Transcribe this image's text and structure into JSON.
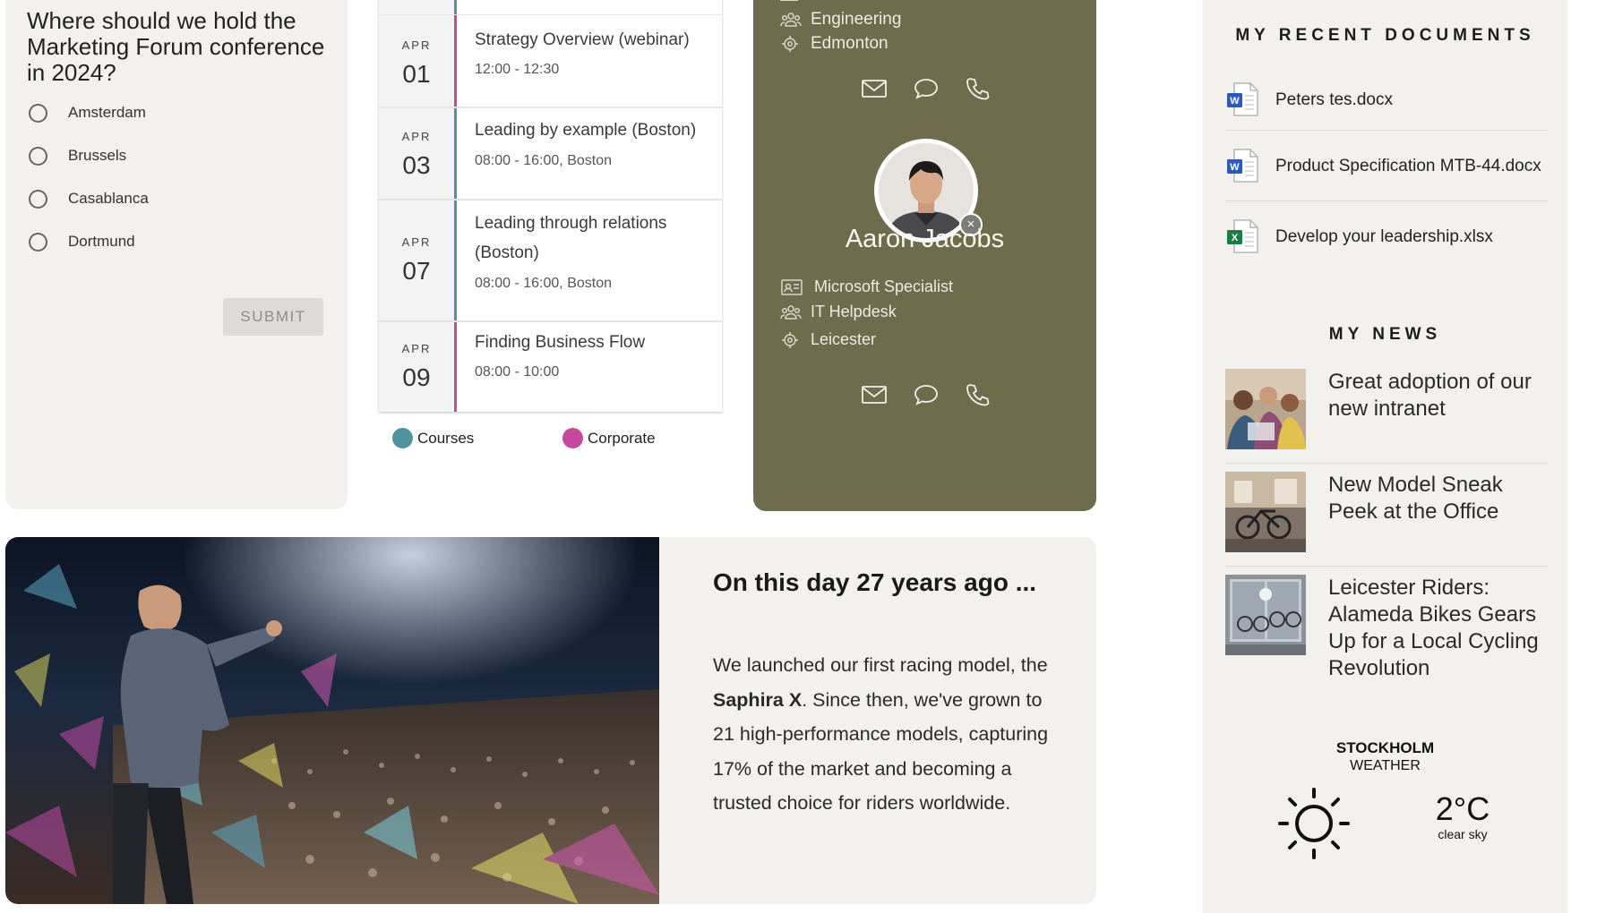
{
  "poll": {
    "question": "Where should we hold the Marketing Forum conference in 2024?",
    "options": [
      "Amsterdam",
      "Brussels",
      "Casablanca",
      "Dortmund"
    ],
    "submit_label": "SUBMIT"
  },
  "events": {
    "items": [
      {
        "month": "APR",
        "day": "01",
        "title": "Strategy Overview (webinar)",
        "time": "12:00 - 12:30",
        "category": "Corporate"
      },
      {
        "month": "APR",
        "day": "03",
        "title": "Leading by example (Boston)",
        "time": "08:00 - 16:00, Boston",
        "category": "Courses"
      },
      {
        "month": "APR",
        "day": "07",
        "title": "Leading through relations (Boston)",
        "time": "08:00 - 16:00, Boston",
        "category": "Courses"
      },
      {
        "month": "APR",
        "day": "09",
        "title": "Finding Business Flow",
        "time": "08:00 - 10:00",
        "category": "Corporate"
      }
    ],
    "legend": [
      {
        "label": "Courses",
        "color": "#4f93a1"
      },
      {
        "label": "Corporate",
        "color": "#c8489f"
      }
    ]
  },
  "people": {
    "previous": {
      "department": "Engineering",
      "location": "Edmonton"
    },
    "person": {
      "name": "Aaron Jacobs",
      "title": "Microsoft Specialist",
      "department": "IT Helpdesk",
      "location": "Leicester"
    },
    "card_color": "#6e6c4c"
  },
  "on_this_day": {
    "heading": "On this day 27 years ago ...",
    "text_before": "We launched our first racing model, the ",
    "highlight": "Saphira X",
    "text_after": ". Since then, we've grown to 21 high-performance models, capturing 17% of the market and becoming a trusted choice for riders worldwide."
  },
  "documents": {
    "heading": "MY RECENT DOCUMENTS",
    "items": [
      {
        "name": "Peters tes.docx",
        "icon": "word-doc-icon"
      },
      {
        "name": "Product Specification MTB-44.docx",
        "icon": "word-doc-icon"
      },
      {
        "name": "Develop your leadership.xlsx",
        "icon": "excel-doc-icon"
      }
    ]
  },
  "news": {
    "heading": "MY NEWS",
    "items": [
      {
        "title": "Great adoption of our new intranet"
      },
      {
        "title": "New Model Sneak Peek at the Office"
      },
      {
        "title": "Leicester Riders: Alameda Bikes Gears Up for a Local Cycling Revolution"
      }
    ]
  },
  "weather": {
    "city": "STOCKHOLM",
    "label": "WEATHER",
    "temperature": "2°C",
    "condition": "clear sky",
    "icon": "sun-icon"
  }
}
